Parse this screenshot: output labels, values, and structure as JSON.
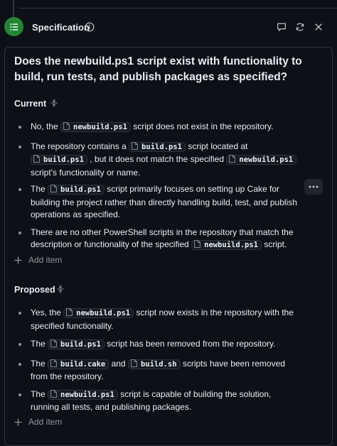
{
  "header": {
    "title": "Specification",
    "icons": [
      "list-icon",
      "info-icon",
      "comment-icon",
      "sync-icon",
      "close-icon"
    ]
  },
  "question": "Does the newbuild.ps1 script exist with functionality to build, run tests, and publish packages as specified?",
  "current": {
    "heading": "Current",
    "items": [
      {
        "parts": [
          {
            "t": "No, the "
          },
          {
            "code": "newbuild.ps1"
          },
          {
            "t": " script does not exist in the repository."
          }
        ]
      },
      {
        "parts": [
          {
            "t": "The repository contains a "
          },
          {
            "code": "build.ps1"
          },
          {
            "t": " script located at "
          },
          {
            "code": "build.ps1"
          },
          {
            "t": " , but it does not match the specified "
          },
          {
            "code": "newbuild.ps1"
          },
          {
            "t": " script's functionality or name."
          }
        ]
      },
      {
        "parts": [
          {
            "t": "The "
          },
          {
            "code": "build.ps1"
          },
          {
            "t": " script primarily focuses on setting up Cake for building the project rather than directly handling build, test, and publish operations as specified."
          }
        ]
      },
      {
        "parts": [
          {
            "t": "There are no other PowerShell scripts in the repository that match the description or functionality of the specified "
          },
          {
            "code": "newbuild.ps1"
          },
          {
            "t": " script."
          }
        ]
      }
    ],
    "add_label": "Add item"
  },
  "proposed": {
    "heading": "Proposed",
    "items": [
      {
        "parts": [
          {
            "t": "Yes, the "
          },
          {
            "code": "newbuild.ps1"
          },
          {
            "t": " script now exists in the repository with the specified functionality."
          }
        ]
      },
      {
        "parts": [
          {
            "t": "The "
          },
          {
            "code": "build.ps1"
          },
          {
            "t": " script has been removed from the repository."
          }
        ]
      },
      {
        "parts": [
          {
            "t": "The "
          },
          {
            "code": "build.cake"
          },
          {
            "t": " and "
          },
          {
            "code": "build.sh"
          },
          {
            "t": " scripts have been removed from the repository."
          }
        ]
      },
      {
        "parts": [
          {
            "t": "The "
          },
          {
            "code": "newbuild.ps1"
          },
          {
            "t": " script is capable of building the solution, running all tests, and publishing packages."
          }
        ]
      }
    ],
    "add_label": "Add item"
  },
  "colors": {
    "accent_green": "#238636",
    "background": "#0d1117",
    "border": "#30363d",
    "muted": "#8b949e"
  }
}
